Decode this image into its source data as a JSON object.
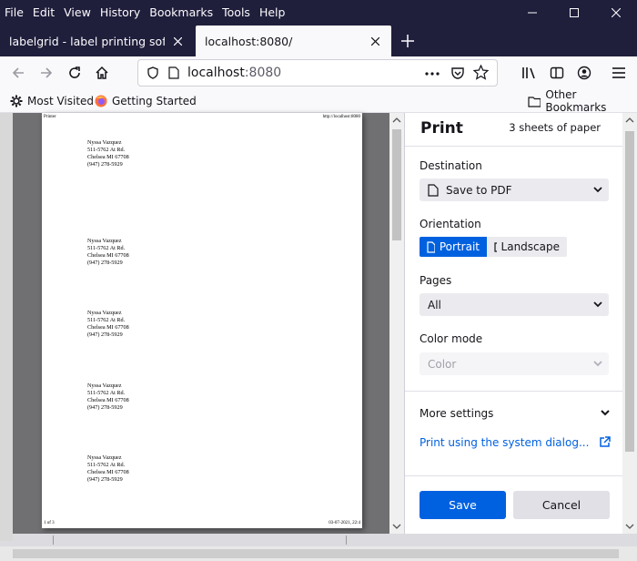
{
  "menu": {
    "file": "File",
    "edit": "Edit",
    "view": "View",
    "history": "History",
    "bookmarks": "Bookmarks",
    "tools": "Tools",
    "help": "Help"
  },
  "tabs": [
    {
      "label": "labelgrid - label printing software, c"
    },
    {
      "label": "localhost:8080/"
    }
  ],
  "urlbar": {
    "host": "localhost",
    "port": ":8080"
  },
  "bookmarks": {
    "most_visited": "Most Visited",
    "getting_started": "Getting Started",
    "other": "Other Bookmarks"
  },
  "paper": {
    "header_left": "Printer",
    "header_right": "http://localhost:8080",
    "footer_left": "1 of 3",
    "footer_right": "03-07-2021, 22:4",
    "labels": [
      {
        "name": "Nyssa Vazquez",
        "street": "511-5762 At Rd.",
        "city": "Chelsea MI 67708",
        "phone": "(947) 278-5929"
      },
      {
        "name": "Nyssa Vazquez",
        "street": "511-5762 At Rd.",
        "city": "Chelsea MI 67708",
        "phone": "(947) 278-5929"
      },
      {
        "name": "Nyssa Vazquez",
        "street": "511-5762 At Rd.",
        "city": "Chelsea MI 67708",
        "phone": "(947) 278-5929"
      },
      {
        "name": "Nyssa Vazquez",
        "street": "511-5762 At Rd.",
        "city": "Chelsea MI 67708",
        "phone": "(947) 278-5929"
      },
      {
        "name": "Nyssa Vazquez",
        "street": "511-5762 At Rd.",
        "city": "Chelsea MI 67708",
        "phone": "(947) 278-5929"
      }
    ]
  },
  "print": {
    "title": "Print",
    "sheets": "3 sheets of paper",
    "destination_label": "Destination",
    "destination_value": "Save to PDF",
    "orientation_label": "Orientation",
    "portrait": "Portrait",
    "landscape": "Landscape",
    "pages_label": "Pages",
    "pages_value": "All",
    "color_label": "Color mode",
    "color_value": "Color",
    "more_settings": "More settings",
    "system_dialog": "Print using the system dialog...",
    "save": "Save",
    "cancel": "Cancel"
  },
  "colors": {
    "accent": "#0061e0",
    "titlebar": "#1f1e3b"
  }
}
